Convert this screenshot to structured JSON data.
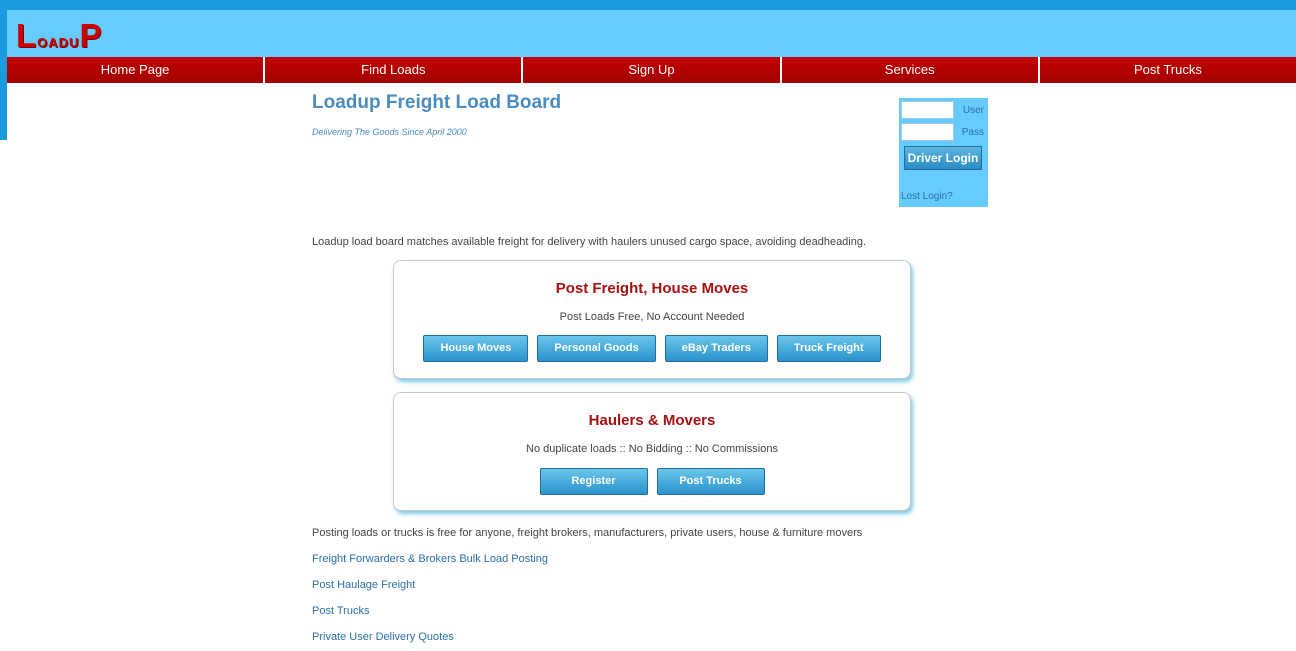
{
  "logo": {
    "first_big": "L",
    "middle_small": "oadu",
    "last_big": "P"
  },
  "nav": [
    {
      "label": "Home Page"
    },
    {
      "label": "Find Loads"
    },
    {
      "label": "Sign Up"
    },
    {
      "label": "Services"
    },
    {
      "label": "Post Trucks"
    }
  ],
  "main": {
    "title": "Loadup Freight Load Board",
    "tagline": "Delivering The Goods Since April 2000",
    "intro": "Loadup load board matches available freight for delivery with haulers unused cargo space, avoiding deadheading."
  },
  "login": {
    "user_label": "User",
    "user_value": "",
    "pass_label": "Pass",
    "pass_value": "",
    "button": "Driver Login",
    "lost": "Lost Login?"
  },
  "freight_card": {
    "title": "Post Freight, House Moves",
    "subtitle": "Post Loads Free, No Account Needed",
    "buttons": [
      "House Moves",
      "Personal Goods",
      "eBay Traders",
      "Truck Freight"
    ]
  },
  "haulers_card": {
    "title": "Haulers & Movers",
    "subtitle": "No duplicate loads :: No Bidding :: No Commissions",
    "buttons": [
      "Register",
      "Post Trucks"
    ]
  },
  "posting_text": "Posting loads or trucks is free for anyone, freight brokers, manufacturers, private users, house & furniture movers",
  "links": [
    "Freight Forwarders & Brokers Bulk Load Posting",
    "Post Haulage Freight",
    "Post Trucks",
    "Private User Delivery Quotes"
  ],
  "colors": {
    "frame": "#1a9be0",
    "header": "#66ccff",
    "nav": "#b30000",
    "logo": "#cc0000",
    "title": "#4a8cc0",
    "card_title": "#a61010",
    "button": "#2a93cb",
    "link": "#2a6fa8"
  }
}
